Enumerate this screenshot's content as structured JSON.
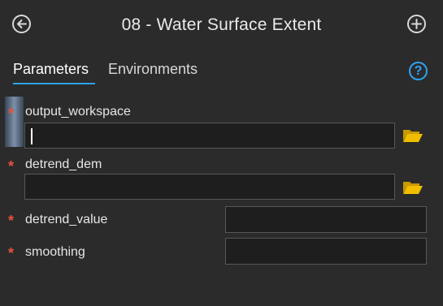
{
  "header": {
    "title": "08 - Water Surface Extent",
    "back_icon": "back-arrow-icon",
    "add_icon": "plus-circle-icon"
  },
  "tabs": [
    {
      "label": "Parameters",
      "active": true
    },
    {
      "label": "Environments",
      "active": false
    }
  ],
  "help": {
    "icon": "help-icon",
    "glyph": "?"
  },
  "parameters": [
    {
      "name": "output_workspace",
      "required": true,
      "value": "",
      "browse": true,
      "focused": true
    },
    {
      "name": "detrend_dem",
      "required": true,
      "value": "",
      "browse": true
    },
    {
      "name": "detrend_value",
      "required": true,
      "value": ""
    },
    {
      "name": "smoothing",
      "required": true,
      "value": ""
    }
  ],
  "required_marker": "*",
  "colors": {
    "background": "#2b2b2b",
    "accent": "#2ea3f2",
    "required": "#e8523a",
    "folder": "#e8b400"
  }
}
